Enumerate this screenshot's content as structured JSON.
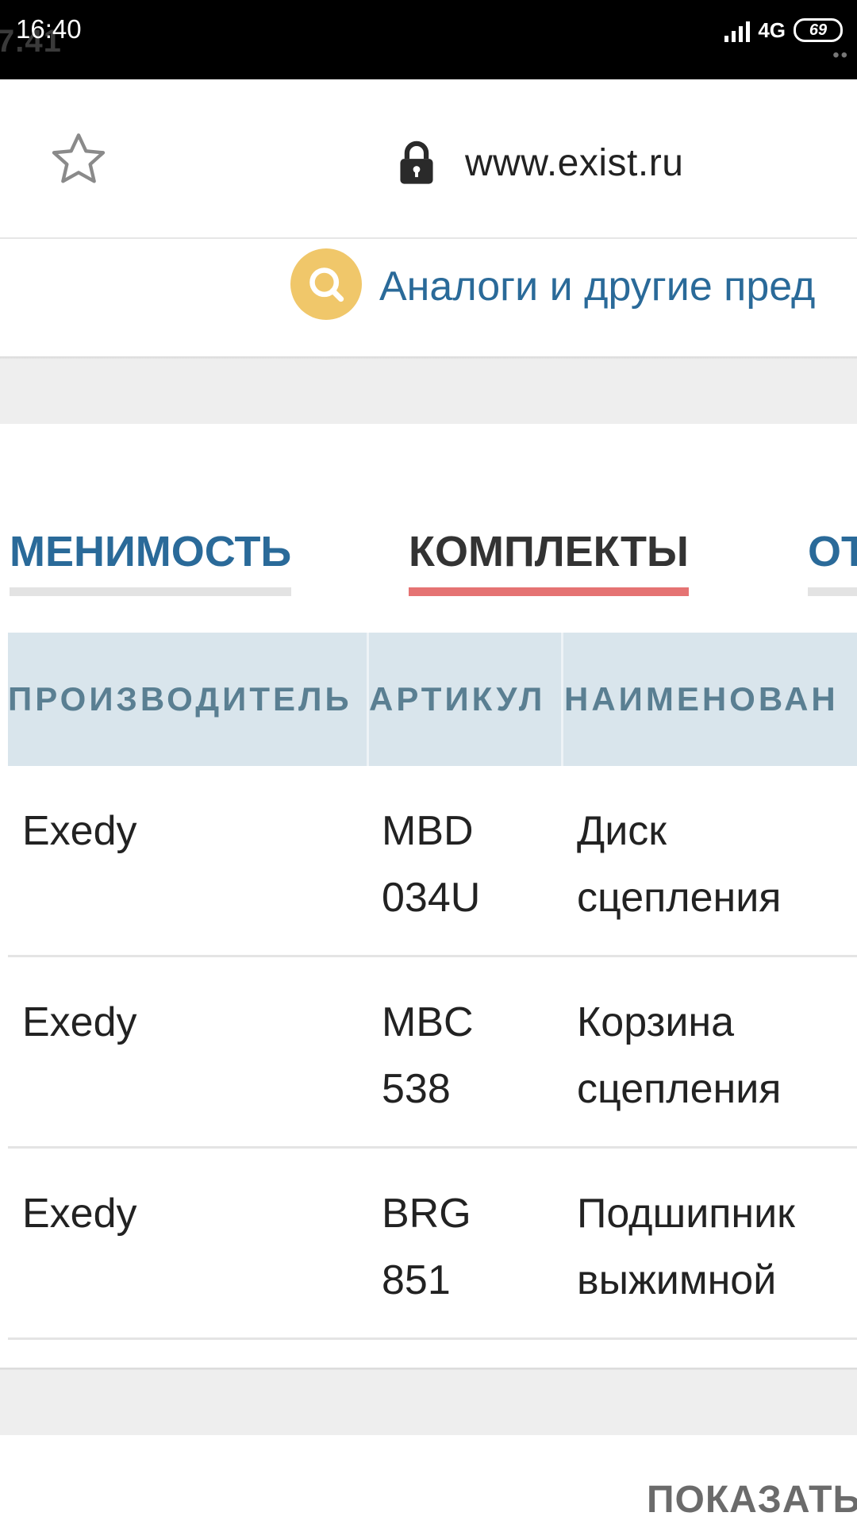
{
  "status_bar": {
    "ghost_text": "7.41",
    "time": "16:40",
    "network": "4G",
    "battery": "69"
  },
  "browser": {
    "url": "www.exist.ru",
    "icons": {
      "bookmark": "star-icon",
      "secure": "lock-icon"
    }
  },
  "header": {
    "analog_link": "Аналоги и другие пред",
    "search_icon": "search-icon"
  },
  "tabs": [
    {
      "label": "МЕНИМОСТЬ",
      "active": false
    },
    {
      "label": "КОМПЛЕКТЫ",
      "active": true
    },
    {
      "label": "ОТ",
      "active": false
    }
  ],
  "table": {
    "columns": [
      "ПРОИЗВОДИТЕЛЬ",
      "АРТИКУЛ",
      "НАИМЕНОВАН"
    ],
    "rows": [
      {
        "maker": "Exedy",
        "article": "MBD 034U",
        "name": "Диск сцепления"
      },
      {
        "maker": "Exedy",
        "article": "MBC 538",
        "name": "Корзина сцепления"
      },
      {
        "maker": "Exedy",
        "article": "BRG 851",
        "name": "Подшипник выжимной"
      }
    ]
  },
  "footer": {
    "show_button": "ПОКАЗАТЬ"
  },
  "colors": {
    "link": "#2a6a99",
    "active_tab_underline": "#e57373",
    "table_header_bg": "#d9e5ec",
    "table_header_text": "#5a7f92",
    "search_badge": "#f0c76a"
  }
}
